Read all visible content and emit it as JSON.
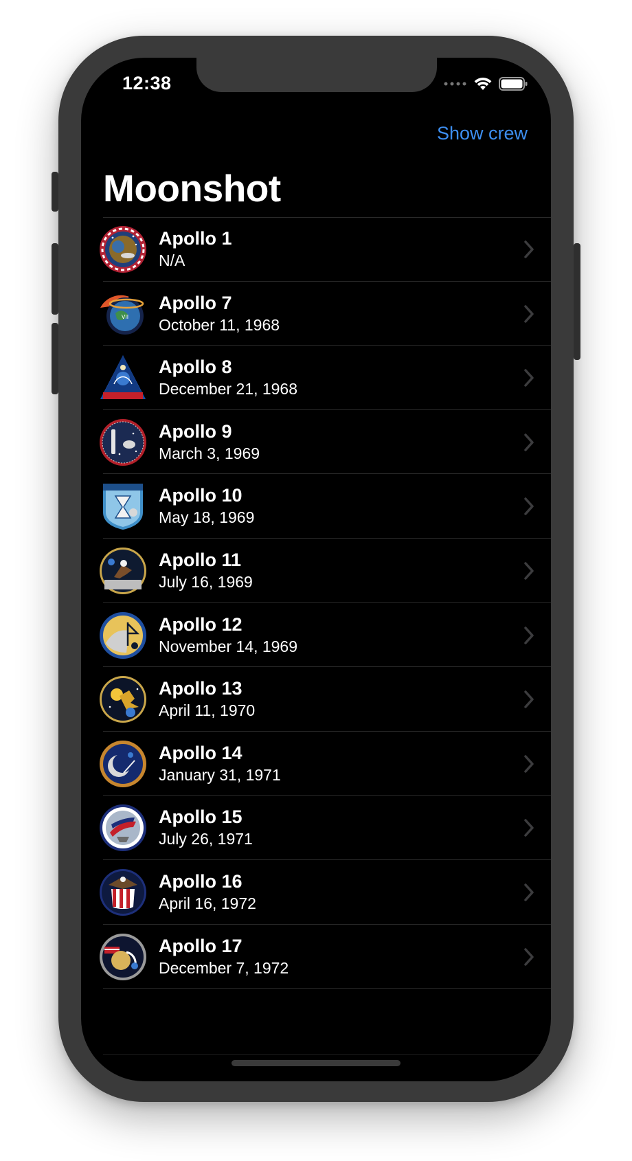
{
  "status_bar": {
    "time": "12:38"
  },
  "nav": {
    "action_label": "Show crew",
    "title": "Moonshot"
  },
  "colors": {
    "accent": "#3d8ef0",
    "background": "#000000",
    "text": "#ffffff",
    "separator": "#2a2a2a"
  },
  "missions": [
    {
      "name": "Apollo 1",
      "date": "N/A",
      "badge": "apollo-1-badge-icon"
    },
    {
      "name": "Apollo 7",
      "date": "October 11, 1968",
      "badge": "apollo-7-badge-icon"
    },
    {
      "name": "Apollo 8",
      "date": "December 21, 1968",
      "badge": "apollo-8-badge-icon"
    },
    {
      "name": "Apollo 9",
      "date": "March 3, 1969",
      "badge": "apollo-9-badge-icon"
    },
    {
      "name": "Apollo 10",
      "date": "May 18, 1969",
      "badge": "apollo-10-badge-icon"
    },
    {
      "name": "Apollo 11",
      "date": "July 16, 1969",
      "badge": "apollo-11-badge-icon"
    },
    {
      "name": "Apollo 12",
      "date": "November 14, 1969",
      "badge": "apollo-12-badge-icon"
    },
    {
      "name": "Apollo 13",
      "date": "April 11, 1970",
      "badge": "apollo-13-badge-icon"
    },
    {
      "name": "Apollo 14",
      "date": "January 31, 1971",
      "badge": "apollo-14-badge-icon"
    },
    {
      "name": "Apollo 15",
      "date": "July 26, 1971",
      "badge": "apollo-15-badge-icon"
    },
    {
      "name": "Apollo 16",
      "date": "April 16, 1972",
      "badge": "apollo-16-badge-icon"
    },
    {
      "name": "Apollo 17",
      "date": "December 7, 1972",
      "badge": "apollo-17-badge-icon"
    }
  ]
}
